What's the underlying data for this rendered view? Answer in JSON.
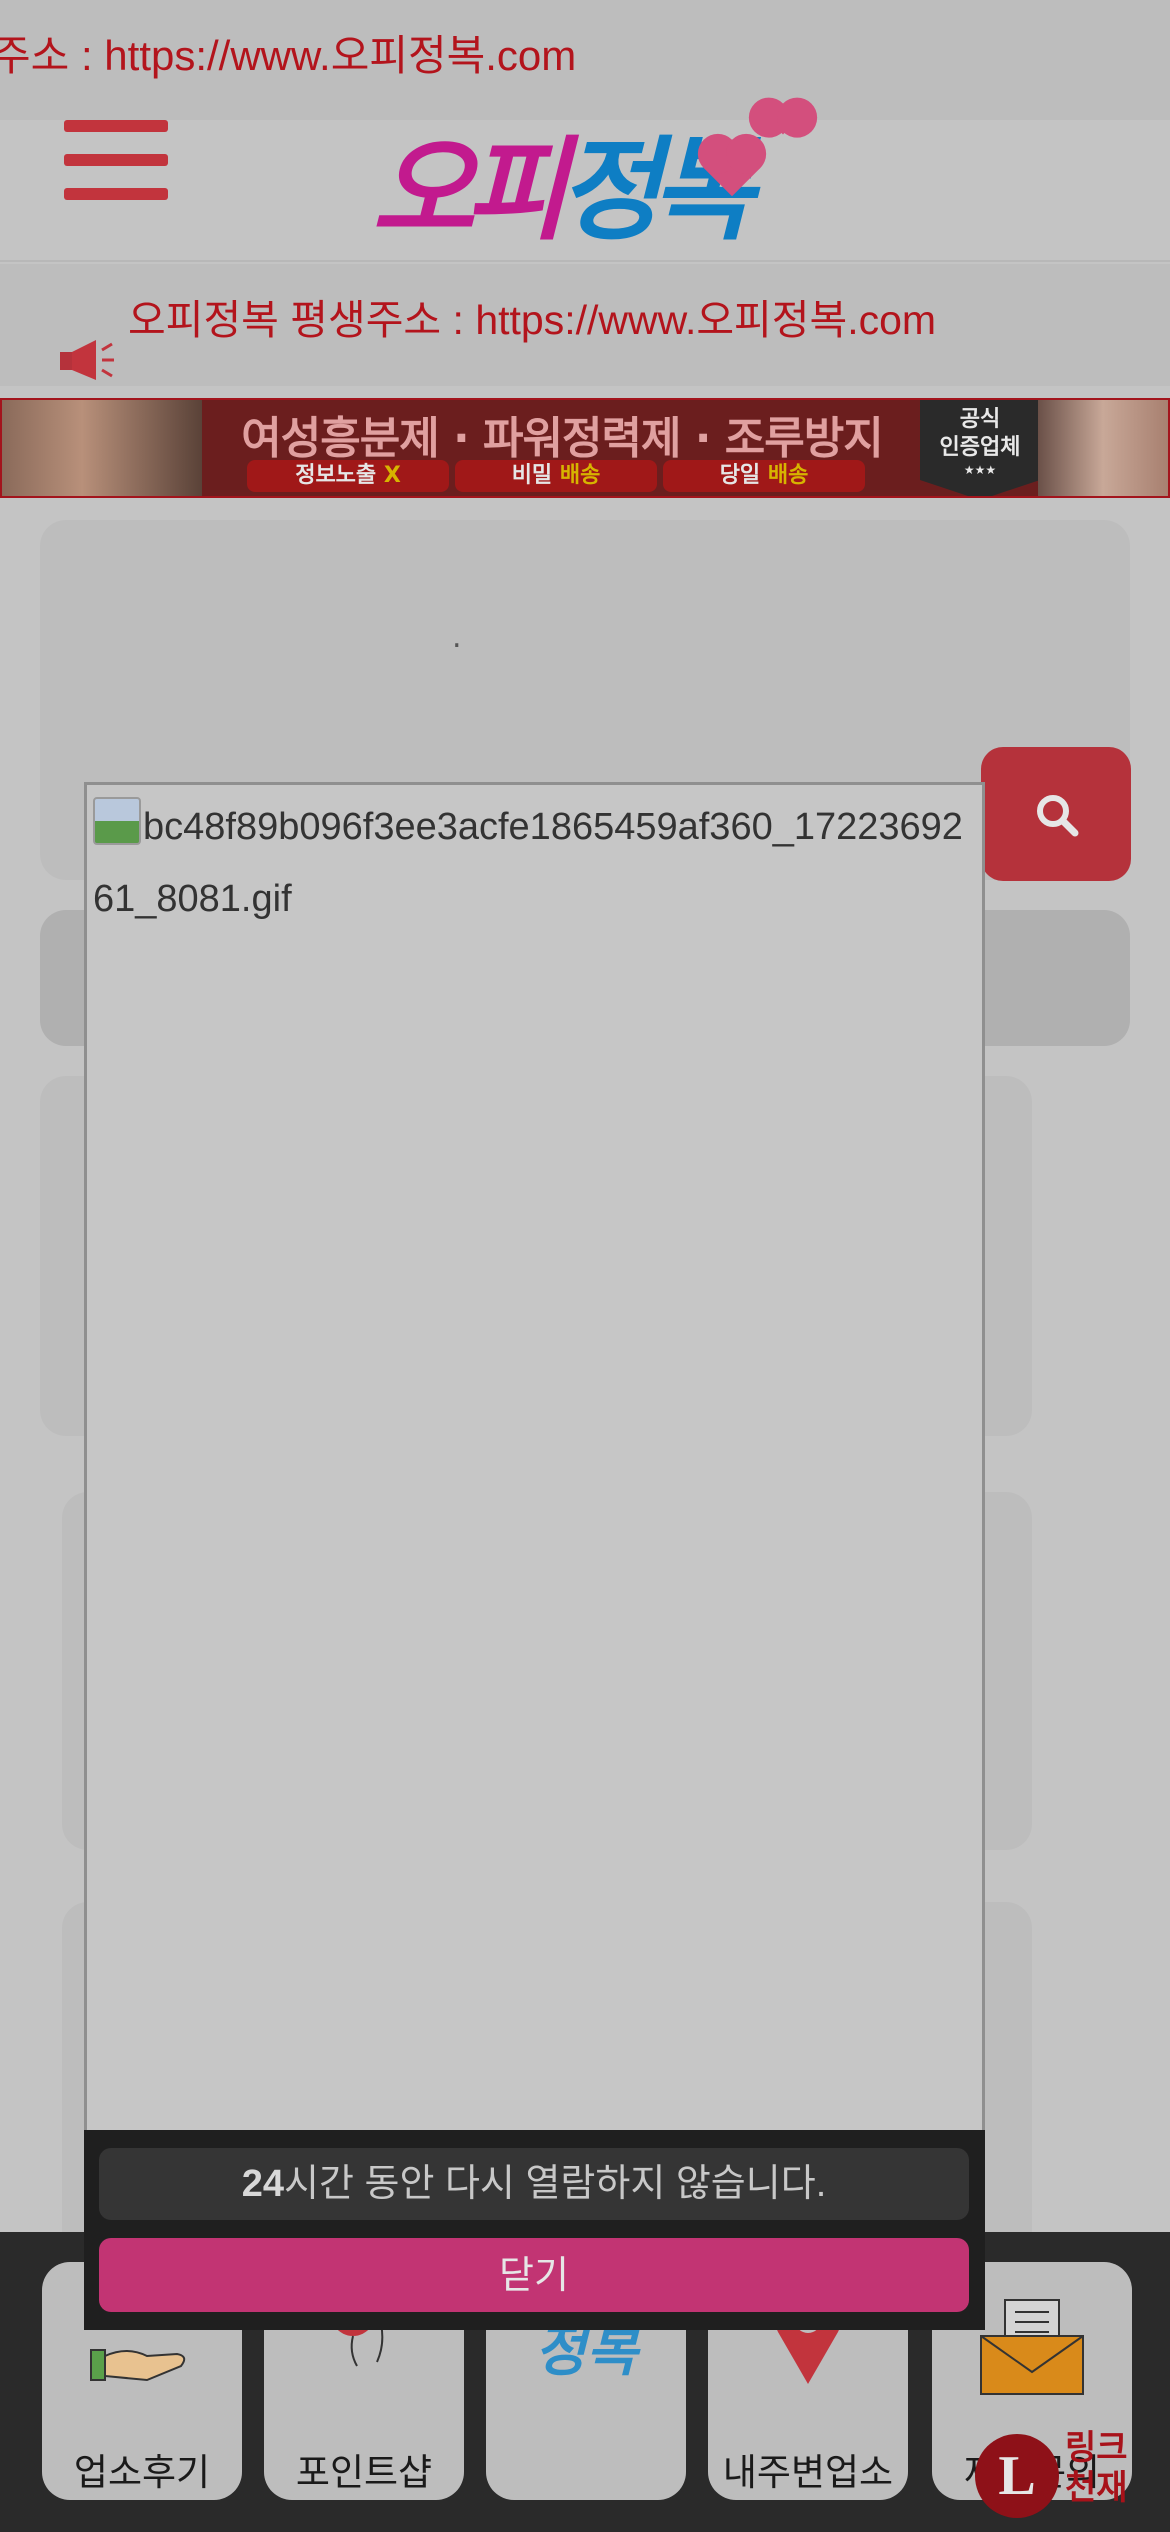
{
  "top_marquee": {
    "text": "주소 : https://www.오피정복.com"
  },
  "header": {
    "logo_text_a": "오피",
    "logo_text_b": "정복"
  },
  "notice": {
    "text": "오피정복 평생주소 : https://www.오피정복.com"
  },
  "banner": {
    "headline": "여성흥분제 · 파워정력제 · 조루방지",
    "pills": [
      {
        "text": "정보노출 ",
        "accent": "X"
      },
      {
        "text": "비밀 ",
        "accent": "배송"
      },
      {
        "text": "당일 ",
        "accent": "배송"
      }
    ],
    "cert_line1": "공식",
    "cert_line2": "인증업체",
    "cert_stars": "★★★"
  },
  "search": {
    "dot": "."
  },
  "popup": {
    "image_alt": "bc48f89b096f3ee3acfe1865459af360_1722369261_8081.gif",
    "hide_24h_prefix": "24",
    "hide_24h_text": "시간 동안 다시 열람하지 않습니다.",
    "close_label": "닫기"
  },
  "bottom_nav": {
    "items": [
      {
        "label": "업소후기",
        "icon": "review-hand-stars-icon"
      },
      {
        "label": "포인트샵",
        "icon": "balloons-icon"
      },
      {
        "label": "",
        "icon": "logo-icon"
      },
      {
        "label": "내주변업소",
        "icon": "map-pin-icon"
      },
      {
        "label": "제휴문의",
        "icon": "envelope-icon"
      }
    ]
  },
  "float_ad": {
    "letter": "L",
    "line1": "링크",
    "line2": "천재"
  },
  "colors": {
    "accent_red": "#c2343d",
    "close_pink": "#c23473",
    "notice_red": "#b3141c"
  }
}
